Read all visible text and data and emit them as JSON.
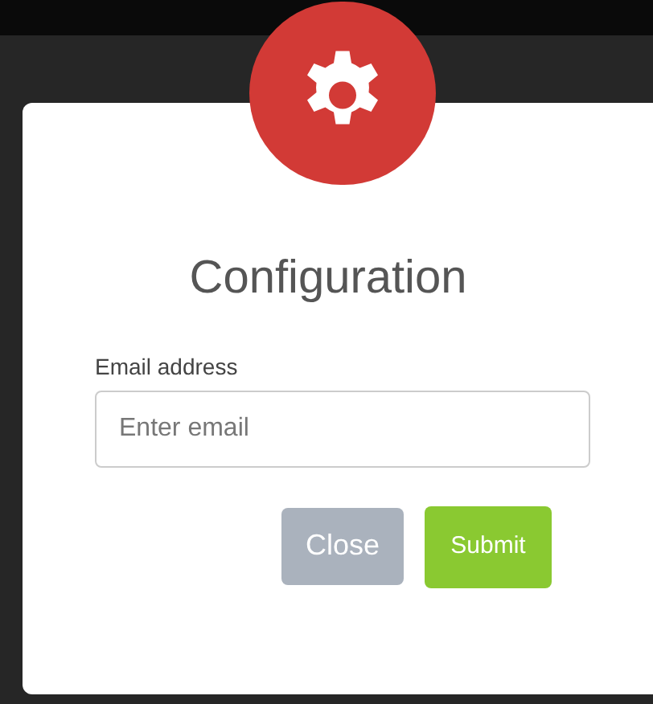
{
  "modal": {
    "title": "Configuration",
    "email_field": {
      "label": "Email address",
      "placeholder": "Enter email"
    },
    "buttons": [
      {
        "kind": "close",
        "label": "Close"
      },
      {
        "kind": "submit",
        "label": "Submit"
      }
    ]
  }
}
